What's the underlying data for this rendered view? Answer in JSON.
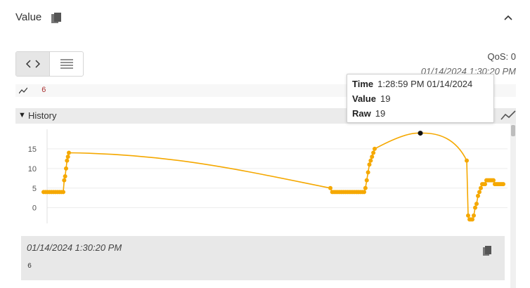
{
  "header": {
    "title": "Value",
    "copy_icon": "copy-icon",
    "collapse_icon": "chevron-up-icon"
  },
  "view_toggle": {
    "options": [
      "code-view-icon",
      "list-view-icon"
    ],
    "active": "code-view-icon"
  },
  "qos": {
    "label": "QoS: 0",
    "timestamp": "01/14/2024 1:30:20 PM"
  },
  "current_value": {
    "icon": "sparkline-icon",
    "value": "6"
  },
  "history": {
    "label": "History",
    "expanded_icon": "triangle-down-icon",
    "trend_icon": "trend-icon"
  },
  "tooltip": {
    "time_label": "Time",
    "time_value": "1:28:59 PM 01/14/2024",
    "value_label": "Value",
    "value_value": "19",
    "raw_label": "Raw",
    "raw_value": "19"
  },
  "chart_data": {
    "type": "line",
    "ylim": [
      -4,
      20
    ],
    "yticks": [
      0,
      5,
      10,
      15
    ],
    "line_color": "#f5a800",
    "highlight_color": "#111111",
    "x": [
      0,
      1,
      2,
      3,
      4,
      5,
      6,
      7,
      8,
      9,
      10,
      11,
      12,
      13,
      14,
      15,
      16,
      17,
      18,
      19,
      20,
      21,
      22,
      23,
      24,
      25,
      26,
      27,
      28,
      29,
      30,
      31,
      32,
      33,
      34,
      35,
      36,
      37,
      38,
      39,
      40,
      41,
      42,
      43,
      44,
      45,
      46,
      47,
      48,
      49,
      50,
      51,
      52,
      53,
      54,
      55,
      56,
      57,
      58,
      59,
      60,
      61,
      62,
      63,
      64,
      65,
      66,
      67,
      68,
      69,
      70,
      71
    ],
    "values": [
      4,
      4,
      4,
      4,
      4,
      4,
      4,
      4,
      4,
      4,
      4,
      7,
      8,
      10,
      12,
      13,
      14,
      5,
      4,
      4,
      4,
      4,
      4,
      4,
      4,
      4,
      4,
      4,
      4,
      4,
      4,
      4,
      4,
      4,
      4,
      4,
      5,
      7,
      9,
      11,
      12,
      13,
      14,
      15,
      19,
      12,
      -2,
      -3,
      -3,
      -3,
      -2,
      0,
      1,
      3,
      4,
      5,
      6,
      6,
      6,
      7,
      7,
      7,
      7,
      7,
      7,
      6,
      6,
      6,
      6,
      6,
      6,
      6
    ],
    "highlight_index": 44,
    "highlight_value": 19
  },
  "record": {
    "timestamp": "01/14/2024 1:30:20 PM",
    "value": "6",
    "copy_icon": "copy-icon"
  }
}
